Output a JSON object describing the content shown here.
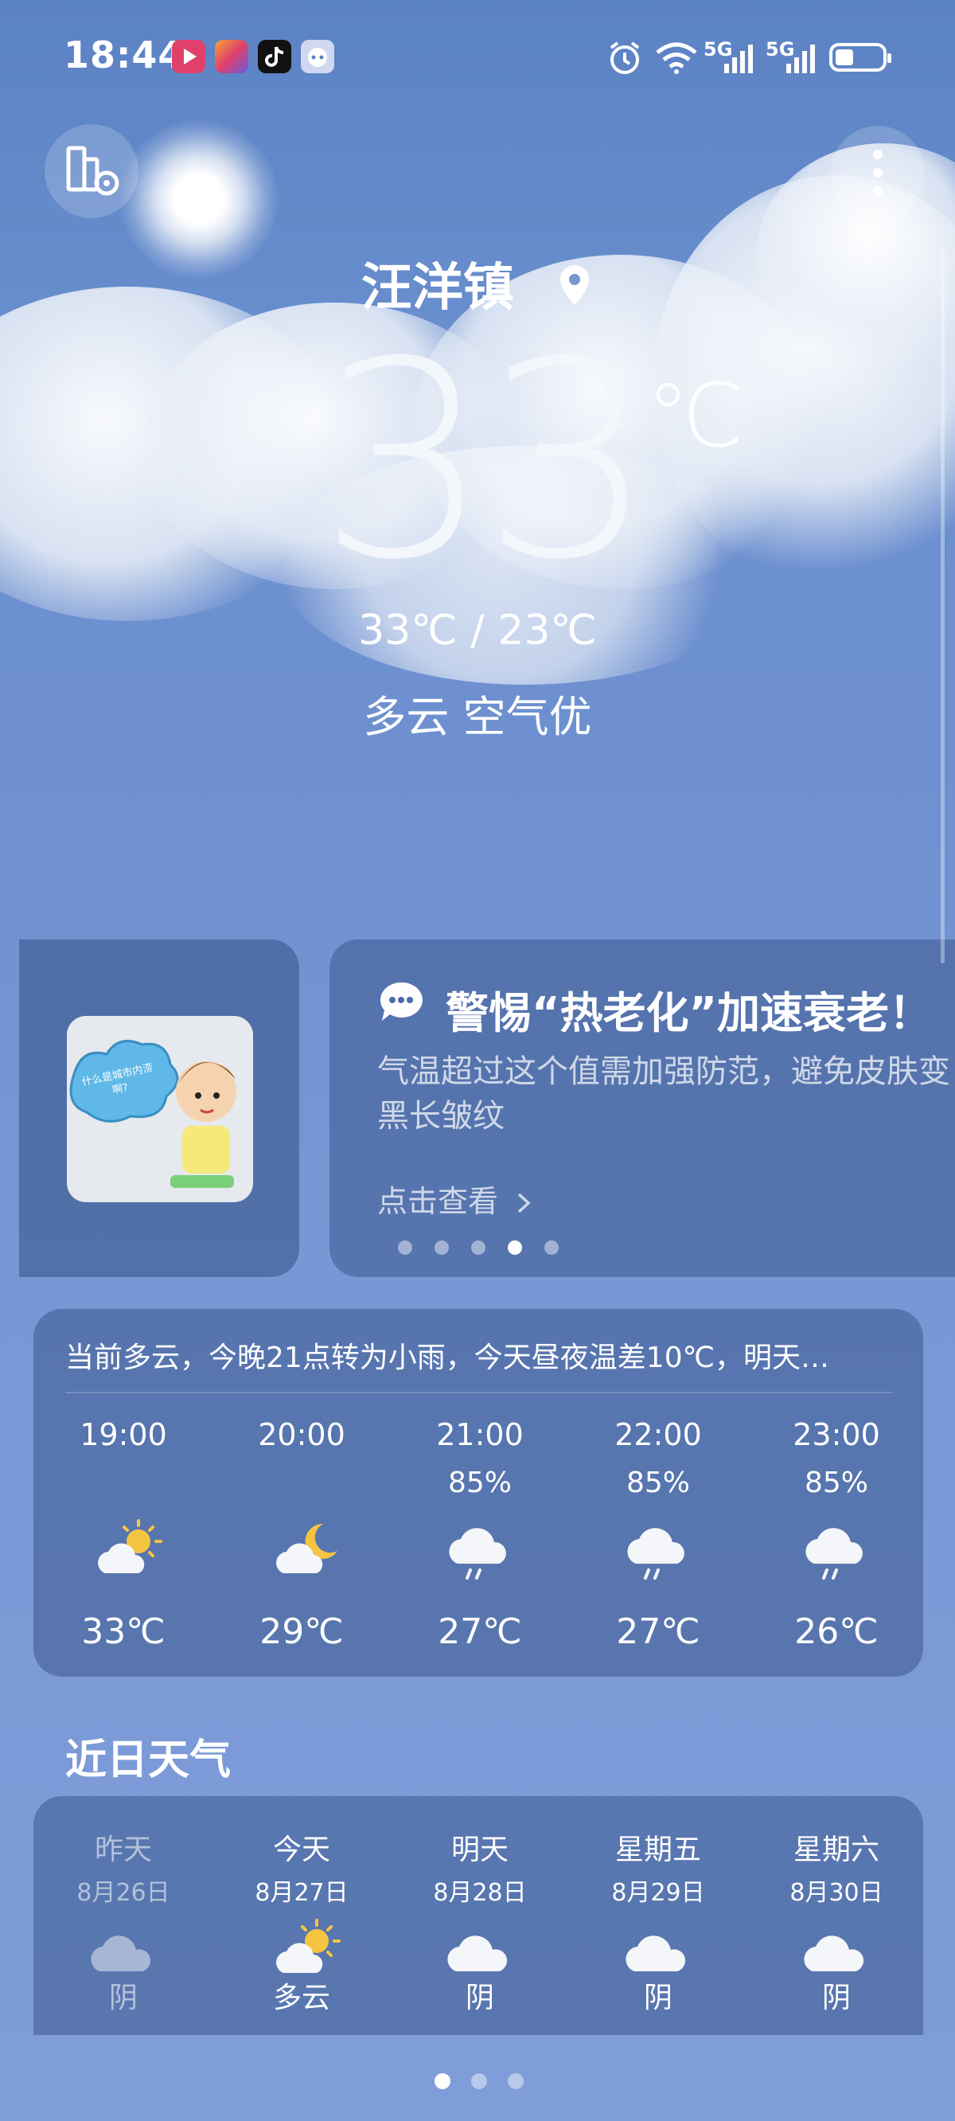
{
  "status_bar": {
    "time": "18:44",
    "network_labels": [
      "5G",
      "5G"
    ],
    "icons": [
      "video-app-icon",
      "gallery-app-icon",
      "tiktok-icon",
      "assistant-app-icon",
      "alarm-icon",
      "wifi-icon",
      "signal-icon",
      "signal-icon",
      "battery-icon"
    ]
  },
  "header": {
    "left_icon": "city-settings-icon",
    "right_icon": "more-vertical-icon",
    "city": "汪洋镇",
    "location_icon": "location-pin-icon"
  },
  "current": {
    "temperature": "33",
    "unit": "℃",
    "range": "33℃ / 23℃",
    "condition": "多云  空气优"
  },
  "news": {
    "icon": "chat-bubble-icon",
    "title": "警惕“热老化”加速衰老！",
    "body": "气温超过这个值需加强防范，避免皮肤变黑长皱纹",
    "link": "点击查看",
    "thumb_caption": "什么是城市内涝啊?",
    "page_count": 5,
    "active_page": 4
  },
  "hourly": {
    "summary": "当前多云，今晚21点转为小雨，今天昼夜温差10℃，明天…",
    "items": [
      {
        "time": "19:00",
        "prob": "",
        "icon": "sun-cloud-icon",
        "temp": "33℃"
      },
      {
        "time": "20:00",
        "prob": "",
        "icon": "moon-cloud-icon",
        "temp": "29℃"
      },
      {
        "time": "21:00",
        "prob": "85%",
        "icon": "rain-cloud-icon",
        "temp": "27℃"
      },
      {
        "time": "22:00",
        "prob": "85%",
        "icon": "rain-cloud-icon",
        "temp": "27℃"
      },
      {
        "time": "23:00",
        "prob": "85%",
        "icon": "rain-cloud-icon",
        "temp": "26℃"
      }
    ]
  },
  "daily": {
    "title": "近日天气",
    "items": [
      {
        "day": "昨天",
        "date": "8月26日",
        "icon": "overcast-icon",
        "cond": "阴",
        "past": true
      },
      {
        "day": "今天",
        "date": "8月27日",
        "icon": "sun-cloud-icon",
        "cond": "多云",
        "past": false
      },
      {
        "day": "明天",
        "date": "8月28日",
        "icon": "overcast-icon",
        "cond": "阴",
        "past": false
      },
      {
        "day": "星期五",
        "date": "8月29日",
        "icon": "overcast-icon",
        "cond": "阴",
        "past": false
      },
      {
        "day": "星期六",
        "date": "8月30日",
        "icon": "overcast-icon",
        "cond": "阴",
        "past": false
      }
    ]
  },
  "pager": {
    "count": 3,
    "active": 1
  },
  "colors": {
    "card": "#4a6aa6",
    "accent_sun": "#f5c542"
  }
}
